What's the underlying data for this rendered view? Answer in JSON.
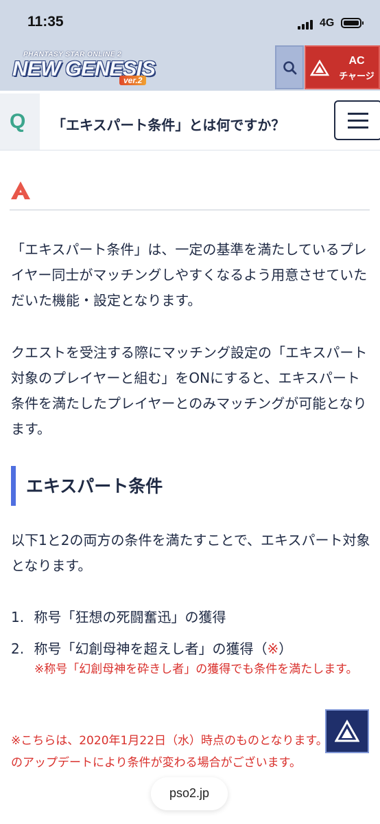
{
  "status_bar": {
    "time": "11:35",
    "network": "4G"
  },
  "header": {
    "logo_top": "PHANTASY STAR ONLINE 2",
    "logo_main": "NEW GENESIS",
    "logo_ver": "ver.2",
    "ac_label": "AC",
    "ac_sub": "チャージ"
  },
  "question": {
    "letter": "Q",
    "title": "「エキスパート条件」とは何ですか？"
  },
  "answer": {
    "letter": "A",
    "paragraph1": "「エキスパート条件」は、一定の基準を満たしているプレイヤー同士がマッチングしやすくなるよう用意させていただいた機能・設定となります。",
    "paragraph2": "クエストを受注する際にマッチング設定の「エキスパート対象のプレイヤーと組む」をONにすると、エキスパート条件を満たしたプレイヤーとのみマッチングが可能となります。",
    "section_title": "エキスパート条件",
    "paragraph3": "以下1と2の両方の条件を満たすことで、エキスパート対象となります。",
    "list": [
      {
        "num": "1.",
        "text": "称号「狂想の死闘奮迅」の獲得"
      },
      {
        "num": "2.",
        "text": "称号「幻創母神を超えし者」の獲得（",
        "mark": "※",
        "close": "）"
      }
    ],
    "note1": "※称号「幻創母神を砕きし者」の獲得でも条件を満たします。",
    "note2": "※こちらは、2020年1月22日（水）時点のものとなります。今後のアップデートにより条件が変わる場合がございます。"
  },
  "browser": {
    "url": "pso2.jp"
  },
  "colors": {
    "accent_blue": "#4f6fe0",
    "q_green": "#3ba58c",
    "a_red": "#e8574a",
    "note_red": "#d9302c",
    "header_bg": "#cfd8e6",
    "ac_red": "#c8312c"
  },
  "icons": [
    "signal-icon",
    "battery-icon",
    "search-icon",
    "ac-triangle-icon",
    "menu-icon",
    "answer-a-icon",
    "back-to-top-icon"
  ]
}
